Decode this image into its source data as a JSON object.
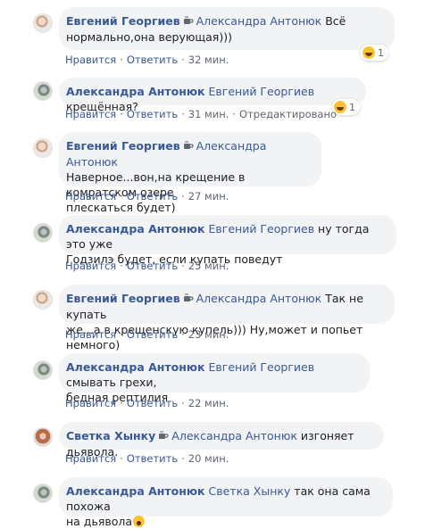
{
  "comments": [
    {
      "author": "Евгений Георгиев",
      "mention": "Александра Антонюк",
      "text_line1": " Всё",
      "text_line2": "нормально,она верующая)))",
      "like": "Нравится",
      "reply": "Ответить",
      "time": "32 мин.",
      "reaction_count": "1"
    },
    {
      "author": "Александра Антонюк",
      "mention": "Евгений Георгиев",
      "text_line1": " крещённая?",
      "like": "Нравится",
      "reply": "Ответить",
      "time": "31 мин.",
      "edited": "Отредактировано",
      "reaction_count": "1"
    },
    {
      "author": "Евгений Георгиев",
      "mention": "Александра Антонюк",
      "text_line2": "Наверное...вон,на крещение в комратском озере",
      "text_line3": "плескаться будет)",
      "like": "Нравится",
      "reply": "Ответить",
      "time": "27 мин."
    },
    {
      "author": "Александра Антонюк",
      "mention": "Евгений Георгиев",
      "text_line1": " ну тогда это уже",
      "text_line2": "Годзилэ будет, если купать поведут",
      "like": "Нравится",
      "reply": "Ответить",
      "time": "25 мин."
    },
    {
      "author": "Евгений Георгиев",
      "mention": "Александра Антонюк",
      "text_line1": " Так не купать",
      "text_line2": "же...а в крещенскую купель))) Ну,может и попьет немного)",
      "like": "Нравится",
      "reply": "Ответить",
      "time": "23 мин."
    },
    {
      "author": "Александра Антонюк",
      "mention": "Евгений Георгиев",
      "text_line1": " смывать грехи,",
      "text_line2": "бедная рептилия",
      "like": "Нравится",
      "reply": "Ответить",
      "time": "22 мин."
    },
    {
      "author": "Светка Хынку",
      "mention": "Александра Антонюк",
      "text_line1": " изгоняет дьявола.",
      "like": "Нравится",
      "reply": "Ответить",
      "time": "20 мин."
    },
    {
      "author": "Александра Антонюк",
      "mention": "Светка Хынку",
      "text_line1": " так она сама похожа",
      "text_line2": "на дьявола",
      "like": "Нравится",
      "reply": "Ответить"
    }
  ],
  "separator": "·",
  "colors": {
    "link": "#385898",
    "bubble": "#f2f3f5",
    "meta": "#606770"
  },
  "icons": {
    "reply": "coffee-cup-icon",
    "reaction": "laughing-emoji-icon",
    "inline_emoji": "screaming-face-emoji-icon"
  }
}
